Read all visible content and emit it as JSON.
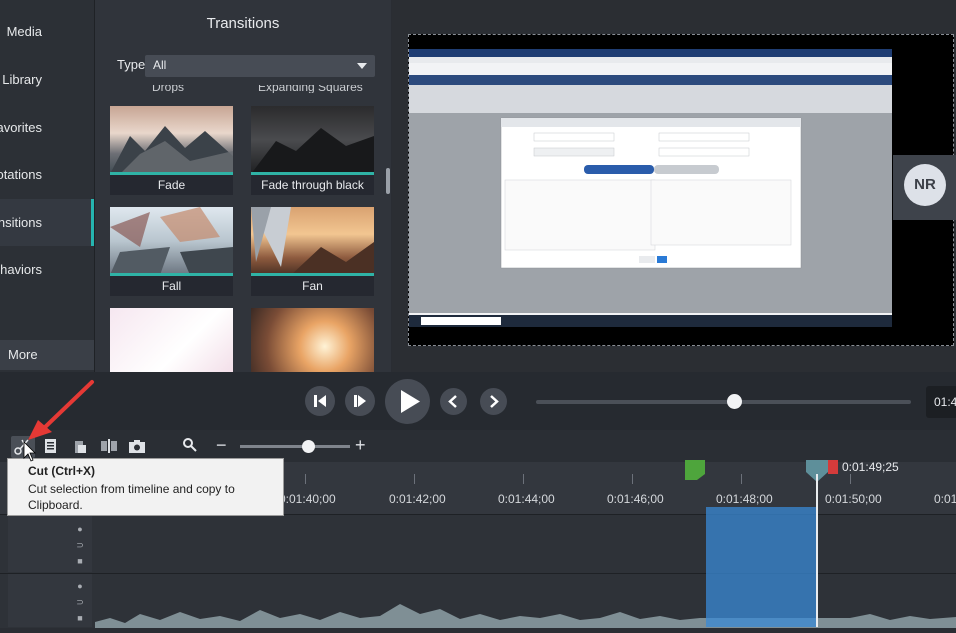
{
  "nav": {
    "items": [
      {
        "label": "Media"
      },
      {
        "label": "Library"
      },
      {
        "label": "Favorites"
      },
      {
        "label": "Annotations"
      },
      {
        "label": "Transitions"
      },
      {
        "label": "Behaviors"
      }
    ],
    "more": "More"
  },
  "transitions": {
    "title": "Transitions",
    "type_label": "Type",
    "type_value": "All",
    "partial_top": [
      "Drops",
      "Expanding Squares"
    ],
    "tiles": [
      {
        "label": "Fade"
      },
      {
        "label": "Fade through black"
      },
      {
        "label": "Fall"
      },
      {
        "label": "Fan"
      }
    ]
  },
  "preview": {
    "participant_initials": "NR"
  },
  "playback": {
    "time": "01:4"
  },
  "timeline": {
    "ticks": [
      "0:01:40;00",
      "0:01:42;00",
      "0:01:44;00",
      "0:01:46;00",
      "0:01:48;00",
      "0:01:50;00",
      "0:01"
    ],
    "playhead_time": "0:01:49;25",
    "zoom_minus": "−",
    "zoom_plus": "+"
  },
  "tooltip": {
    "title": "Cut (Ctrl+X)",
    "body": "Cut selection from timeline and copy to Clipboard."
  },
  "colors": {
    "accent": "#26b5b0",
    "selection": "#3a8ad6",
    "marker_green": "#4ea53c",
    "marker_red": "#d43b3b",
    "arrow": "#e53935"
  }
}
